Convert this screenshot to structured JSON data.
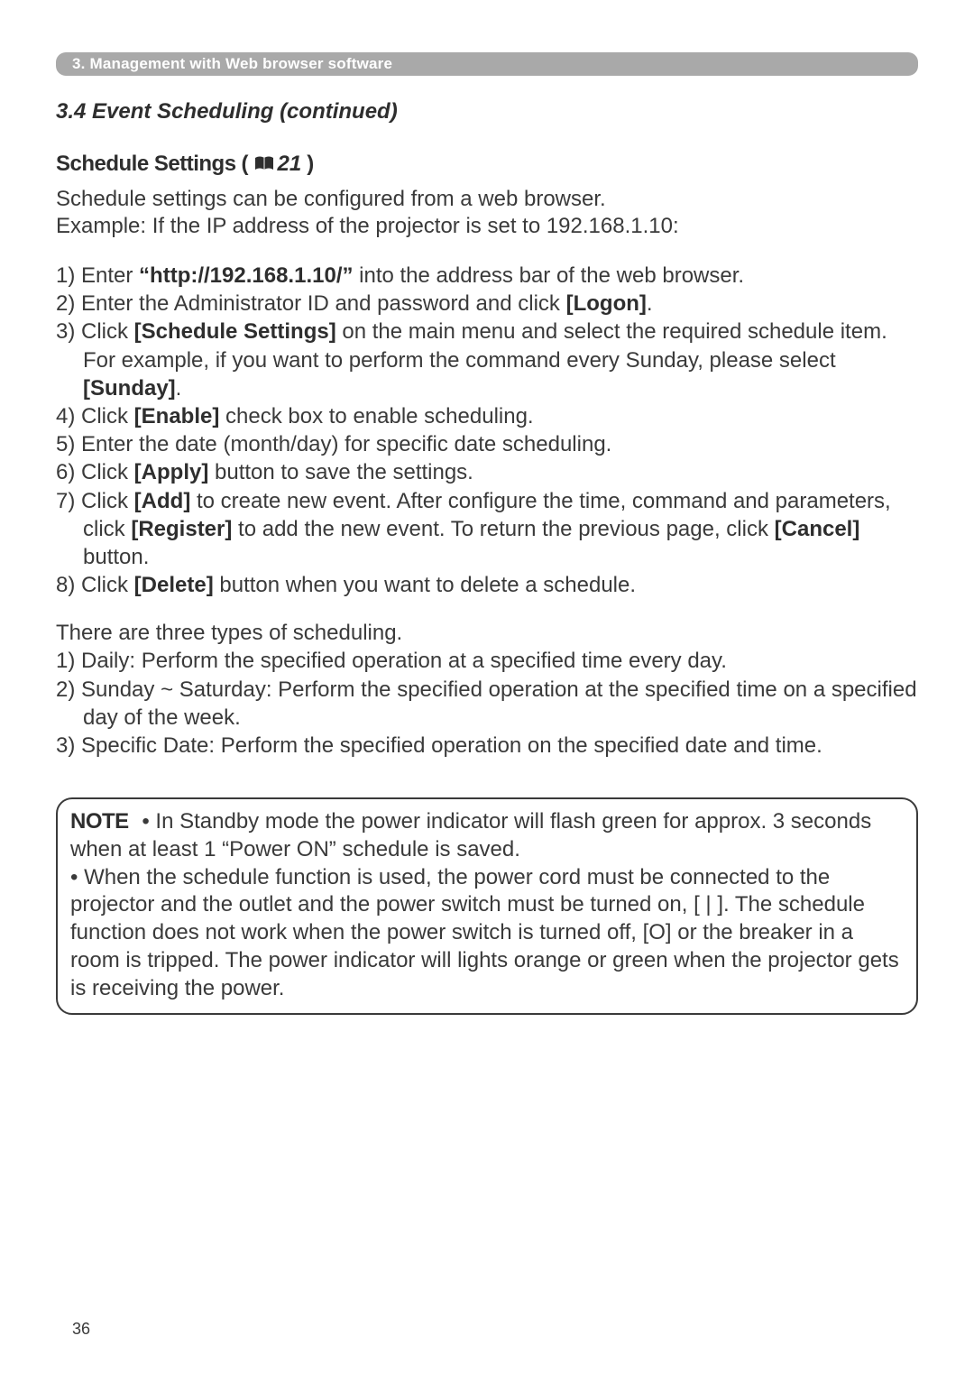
{
  "chapter_bar": "3. Management with Web browser software",
  "section_title": "3.4 Event Scheduling (continued)",
  "sub_heading": {
    "main": "Schedule Settings",
    "refnum": "21"
  },
  "intro": {
    "line1": "Schedule settings can be configured from a web browser.",
    "line2": "Example: If the IP address of the projector is set to 192.168.1.10:"
  },
  "steps": {
    "s1a": "1) Enter ",
    "s1b": "“http://192.168.1.10/”",
    "s1c": " into the address bar of the web browser.",
    "s2a": "2) Enter the Administrator ID and password and click ",
    "s2b": "[Logon]",
    "s2c": ".",
    "s3a": "3) Click ",
    "s3b": "[Schedule Settings]",
    "s3c": " on the main menu and select the required schedule item. For example, if you want to perform the command every Sunday, please select ",
    "s3d": "[Sunday]",
    "s3e": ".",
    "s4a": "4) Click ",
    "s4b": "[Enable]",
    "s4c": " check box to enable scheduling.",
    "s5": "5) Enter the date (month/day) for specific date scheduling.",
    "s6a": "6) Click ",
    "s6b": "[Apply]",
    "s6c": " button to save the settings.",
    "s7a": "7) Click ",
    "s7b": "[Add]",
    "s7c": " to create new event. After configure the time, command and parameters, click ",
    "s7d": "[Register]",
    "s7e": " to add the new event. To return the previous page, click ",
    "s7f": "[Cancel]",
    "s7g": " button.",
    "s8a": "8) Click ",
    "s8b": "[Delete]",
    "s8c": " button when you want to delete a schedule."
  },
  "types_intro": "There are three types of scheduling.",
  "types": {
    "t1": "1) Daily: Perform the specified operation at a specified time every day.",
    "t2": "2) Sunday ~ Saturday: Perform the specified operation at the specified time on a specified day of the week.",
    "t3": "3) Specific Date: Perform the specified operation on the specified date and time."
  },
  "note": {
    "label": "NOTE",
    "body": " • In Standby mode the power indicator will flash green for approx. 3 seconds when at least 1 “Power ON” schedule is saved.\n• When the schedule function is used, the power cord must be connected to the projector and the outlet and the power switch must be turned on, [ | ]. The schedule function does not work when the power switch is turned off, [O] or the breaker in a room is tripped. The power indicator will lights orange or green when the projector gets is receiving the power."
  },
  "page_number": "36"
}
